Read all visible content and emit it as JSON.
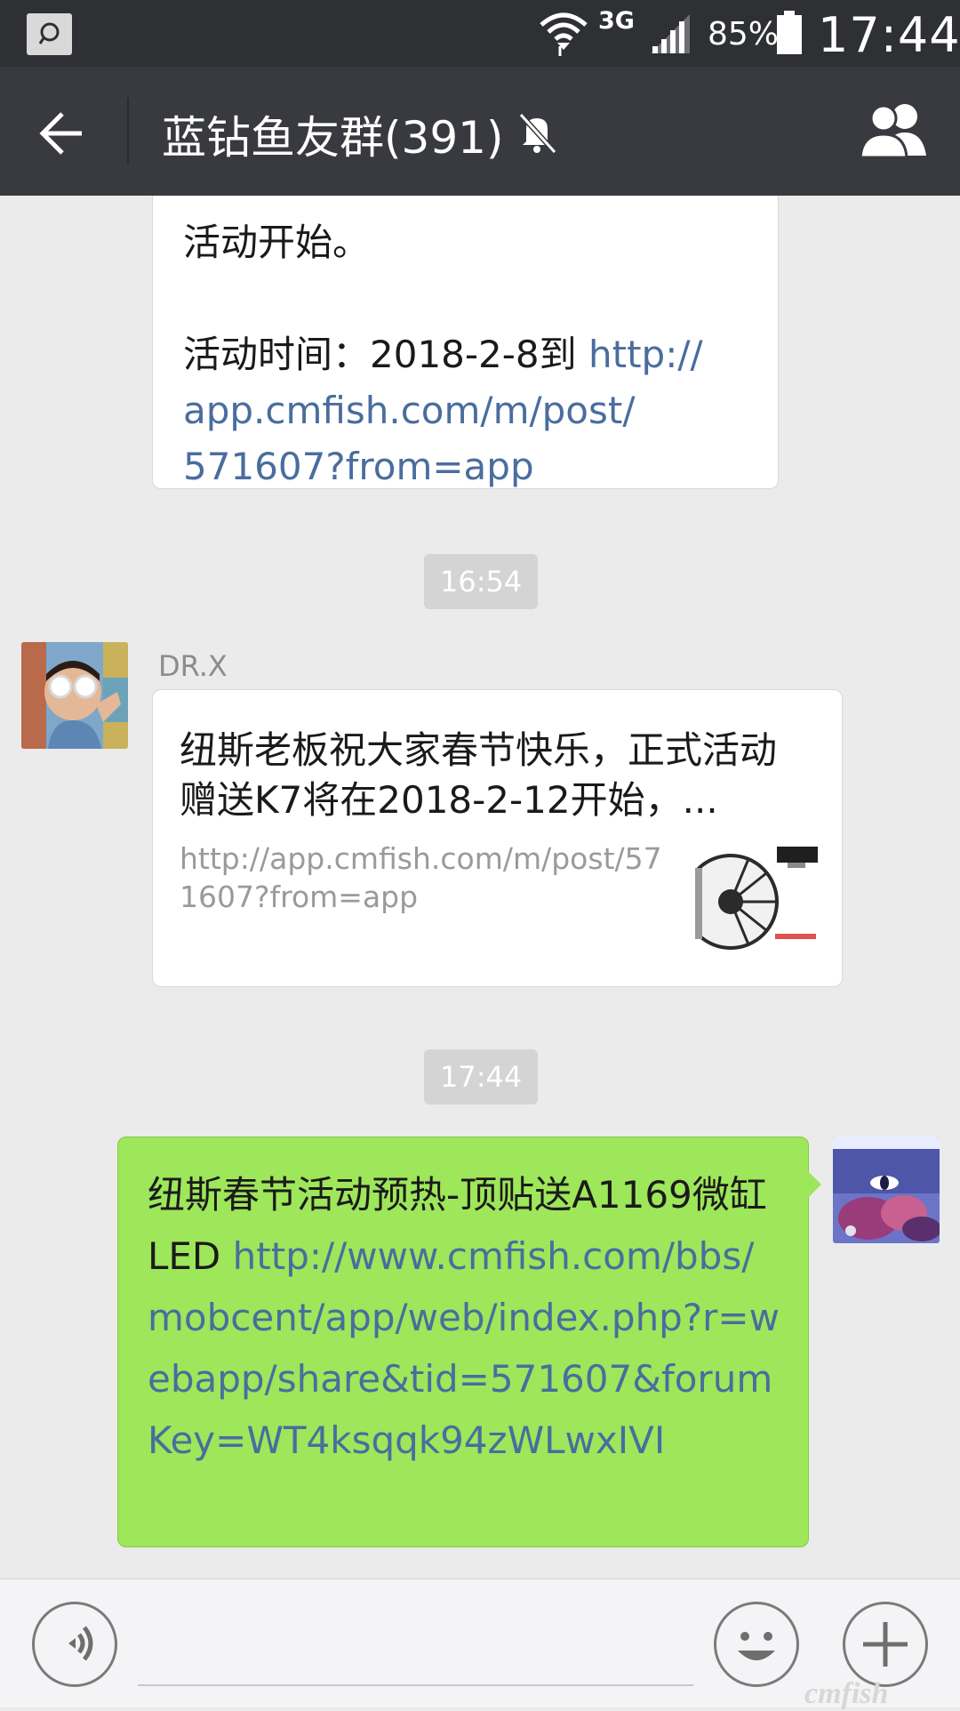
{
  "status_bar": {
    "network": "3G",
    "battery_percent": "85%",
    "battery_level": 0.85,
    "time": "17:44"
  },
  "header": {
    "title": "蓝钻鱼友群(391)",
    "muted": true
  },
  "messages": {
    "partial": {
      "line1": "活动开始。",
      "line2_text": "活动时间：2018-2-8到 ",
      "line2_link": "http://",
      "line3_link": "app.cmfish.com/m/post/",
      "line4_link": "571607?from=app"
    },
    "timestamp1": "16:54",
    "sender1": "DR.X",
    "link_card": {
      "title": "纽斯老板祝大家春节快乐，正式活动赠送K7将在2018-2-12开始，...",
      "url": "http://app.cmfish.com/m/post/571607?from=app"
    },
    "timestamp2": "17:44",
    "mine": {
      "text": "纽斯春节活动预热-顶贴送A1169微缸LED ",
      "link": "http://www.cmfish.com/bbs/mobcent/app/web/index.php?r=webapp/share&tid=571607&forumKey=WT4ksqqk94zWLwxIVI"
    }
  },
  "watermark": "cmfish",
  "icons": {
    "back": "arrow-left-icon",
    "mute": "bell-off-icon",
    "members": "group-icon",
    "voice": "voice-icon",
    "emoji": "smiley-icon",
    "plus": "plus-icon"
  },
  "colors": {
    "header_bg": "#393a3f",
    "statusbar_bg": "#2e3033",
    "chat_bg": "#ebebeb",
    "my_bubble": "#9ee65a",
    "link": "#4a6d9e"
  }
}
